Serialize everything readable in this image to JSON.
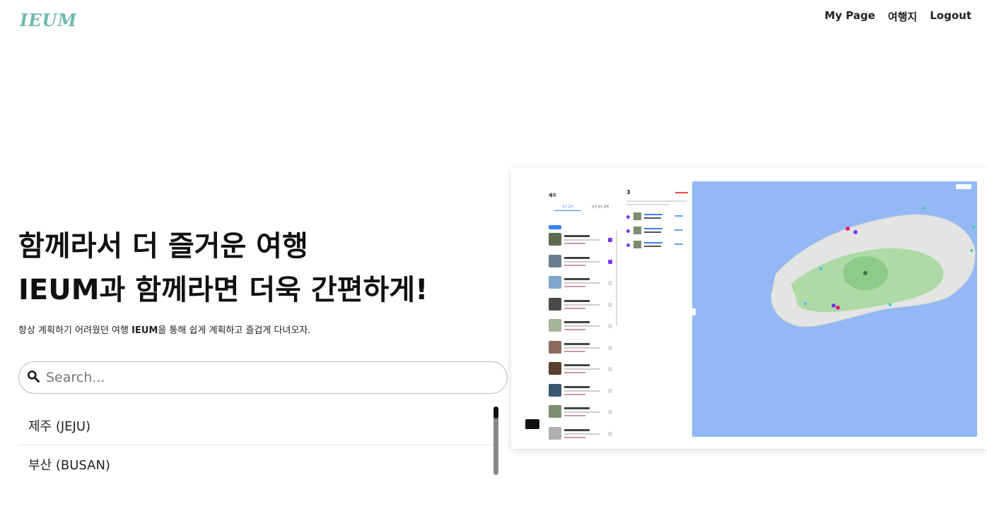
{
  "header": {
    "logo": "IEUM",
    "nav": [
      "My Page",
      "여행지",
      "Logout"
    ]
  },
  "hero": {
    "title_line1": "함께라서 더 즐거운 여행",
    "title_line2": "IEUM과 함께라면 더욱 간편하게!",
    "subtitle_pre": "항상 계획하기 어려웠던 여행 ",
    "subtitle_brand": "IEUM",
    "subtitle_post": "을 통해 쉽게 계획하고 즐겁게 다녀오자."
  },
  "search": {
    "placeholder": "Search...",
    "value": ""
  },
  "destinations": [
    "제주 (JEJU)",
    "부산 (BUSAN)"
  ],
  "preview": {
    "region": "제주",
    "tab_active": "장소 검색",
    "tab_other": "신규 장소 등록",
    "plan_count": "3",
    "map_color": "#93b8f5",
    "accent": "#7c3aed"
  }
}
